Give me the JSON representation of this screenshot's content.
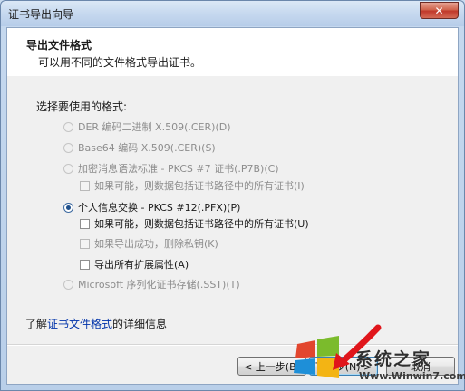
{
  "window": {
    "title": "证书导出向导",
    "close_glyph": "✕"
  },
  "header": {
    "title": "导出文件格式",
    "subtitle": "可以用不同的文件格式导出证书。"
  },
  "prompt": "选择要使用的格式:",
  "options": {
    "der": "DER 编码二进制 X.509(.CER)(D)",
    "base64": "Base64 编码 X.509(.CER)(S)",
    "pkcs7": "加密消息语法标准 - PKCS #7 证书(.P7B)(C)",
    "pkcs7_include": "如果可能，则数据包括证书路径中的所有证书(I)",
    "pfx": "个人信息交换 - PKCS #12(.PFX)(P)",
    "pfx_include": "如果可能，则数据包括证书路径中的所有证书(U)",
    "pfx_delete_key": "如果导出成功，删除私钥(K)",
    "pfx_export_ext": "导出所有扩展属性(A)",
    "sst": "Microsoft 序列化证书存储(.SST)(T)"
  },
  "learn_more": {
    "prefix": "了解",
    "link": "证书文件格式",
    "suffix": "的详细信息"
  },
  "buttons": {
    "back": "< 上一步(B)",
    "next": "下一步(N) >",
    "cancel": "取消"
  },
  "watermark": {
    "brand": "系统之家",
    "url": "Www.Winwin7.com"
  }
}
